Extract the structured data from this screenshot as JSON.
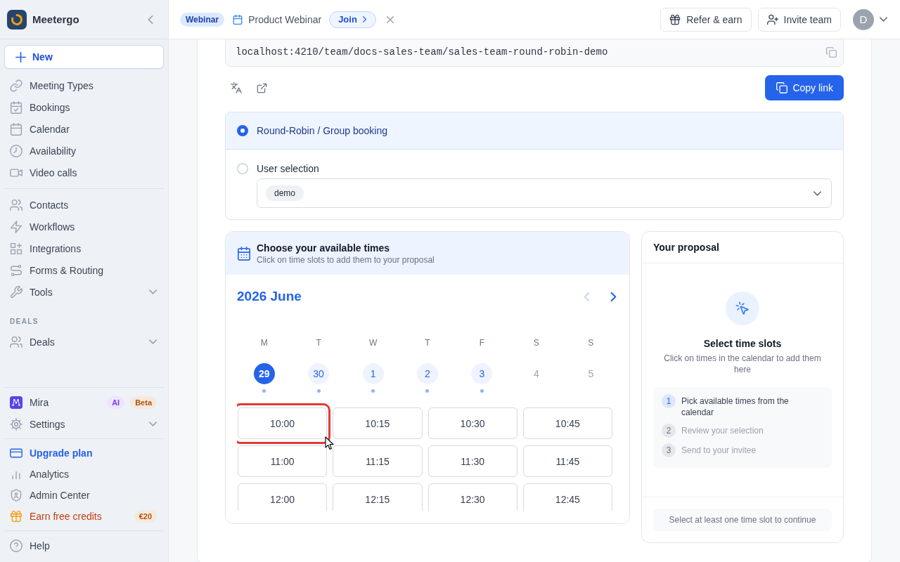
{
  "sidebar": {
    "brand": {
      "name": "Meetergo"
    },
    "new_button": {
      "label": "New"
    },
    "groups": [
      {
        "items": [
          {
            "label": "Meeting Types",
            "kind": "nav",
            "expandable": false
          },
          {
            "label": "Bookings",
            "kind": "nav",
            "expandable": false
          },
          {
            "label": "Calendar",
            "kind": "nav",
            "expandable": false
          },
          {
            "label": "Availability",
            "kind": "nav",
            "expandable": false
          },
          {
            "label": "Video calls",
            "kind": "nav",
            "expandable": false
          }
        ]
      },
      {
        "items": [
          {
            "label": "Contacts",
            "kind": "nav",
            "expandable": false
          },
          {
            "label": "Workflows",
            "kind": "nav",
            "expandable": false
          },
          {
            "label": "Integrations",
            "kind": "nav",
            "expandable": false
          },
          {
            "label": "Forms & Routing",
            "kind": "nav",
            "expandable": false
          },
          {
            "label": "Tools",
            "kind": "nav",
            "expandable": true
          }
        ]
      },
      {
        "heading": "DEALS",
        "items": [
          {
            "label": "Deals",
            "kind": "nav",
            "expandable": true
          }
        ]
      }
    ],
    "footer_groups": [
      {
        "items": [
          {
            "label": "Mira",
            "kind": "nav",
            "expandable": false,
            "badges": [
              {
                "text": "AI",
                "color": "#7c3aed"
              },
              {
                "text": "Beta",
                "color": "#b45309"
              }
            ]
          },
          {
            "label": "Settings",
            "kind": "nav",
            "expandable": true
          }
        ]
      },
      {
        "items": [
          {
            "label": "Upgrade plan",
            "kind": "upgrade",
            "expandable": false
          },
          {
            "label": "Analytics",
            "kind": "nav",
            "expandable": false
          },
          {
            "label": "Admin Center",
            "kind": "nav",
            "expandable": false
          },
          {
            "label": "Earn free credits",
            "kind": "reward",
            "expandable": false,
            "badges": [
              {
                "text": "€20",
                "color": "#b45309"
              }
            ]
          }
        ]
      },
      {
        "items": [
          {
            "label": "Help",
            "kind": "nav",
            "expandable": false
          }
        ]
      }
    ]
  },
  "topbar": {
    "event": {
      "tag": "Webinar",
      "title": "Product Webinar",
      "join_label": "Join"
    },
    "actions": [
      {
        "label": "Refer & earn"
      },
      {
        "label": "Invite team"
      }
    ],
    "avatar": {
      "initial": "D"
    }
  },
  "booking_link": {
    "url": "localhost:4210/team/docs-sales-team/sales-team-round-robin-demo",
    "copy_label": "Copy link"
  },
  "assignment": {
    "options": [
      {
        "label": "Round-Robin / Group booking",
        "selected": true
      },
      {
        "label": "User selection",
        "selected": false,
        "chips": [
          "demo"
        ]
      }
    ]
  },
  "availability": {
    "title": "Choose your available times",
    "subtitle": "Click on time slots to add them to your proposal",
    "month": "2026 June",
    "prev_disabled": true,
    "next_disabled": false,
    "weekdays": [
      "M",
      "T",
      "W",
      "T",
      "F",
      "S",
      "S"
    ],
    "days": [
      {
        "label": "29",
        "selected": true,
        "available": true
      },
      {
        "label": "30",
        "selected": false,
        "available": true
      },
      {
        "label": "1",
        "selected": false,
        "available": true
      },
      {
        "label": "2",
        "selected": false,
        "available": true
      },
      {
        "label": "3",
        "selected": false,
        "available": true
      },
      {
        "label": "4",
        "selected": false,
        "available": false
      },
      {
        "label": "5",
        "selected": false,
        "available": false
      }
    ],
    "slots": [
      {
        "label": "10:00",
        "highlighted": true
      },
      {
        "label": "10:15",
        "highlighted": false
      },
      {
        "label": "10:30",
        "highlighted": false
      },
      {
        "label": "10:45",
        "highlighted": false
      },
      {
        "label": "11:00",
        "highlighted": false
      },
      {
        "label": "11:15",
        "highlighted": false
      },
      {
        "label": "11:30",
        "highlighted": false
      },
      {
        "label": "11:45",
        "highlighted": false
      },
      {
        "label": "12:00",
        "highlighted": false
      },
      {
        "label": "12:15",
        "highlighted": false
      },
      {
        "label": "12:30",
        "highlighted": false
      },
      {
        "label": "12:45",
        "highlighted": false
      }
    ]
  },
  "proposal": {
    "title": "Your proposal",
    "empty_title": "Select time slots",
    "empty_text": "Click on times in the calendar to add them here",
    "steps": [
      {
        "number": "1",
        "text": "Pick available times from the calendar",
        "active": true
      },
      {
        "number": "2",
        "text": "Review your selection",
        "active": false
      },
      {
        "number": "3",
        "text": "Send to your invitee",
        "active": false
      }
    ],
    "footer_hint": "Select at least one time slot to continue"
  }
}
